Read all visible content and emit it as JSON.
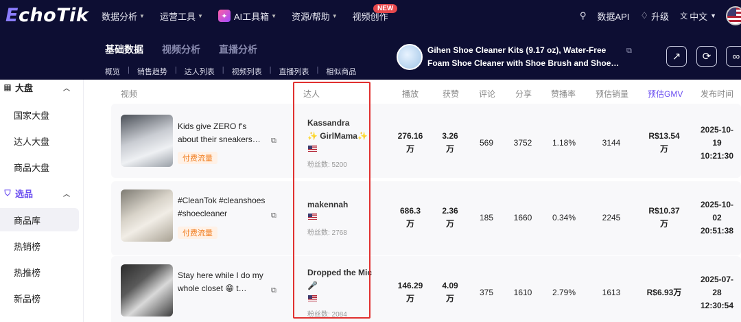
{
  "logo": {
    "first": "E",
    "rest": "choTik"
  },
  "nav": {
    "items": [
      {
        "label": "数据分析",
        "chevron": true
      },
      {
        "label": "运营工具",
        "chevron": true
      },
      {
        "label": "AI工具箱",
        "chevron": true,
        "icon": "ai-sparkle-icon"
      },
      {
        "label": "资源/帮助",
        "chevron": true
      },
      {
        "label": "视频创作",
        "chevron": false
      }
    ],
    "new_badge": "NEW",
    "right": {
      "data_api": "数据API",
      "upgrade": "升级",
      "language": "中文"
    }
  },
  "subheader": {
    "tabs": [
      "基础数据",
      "视频分析",
      "直播分析"
    ],
    "links": [
      "概览",
      "销售趋势",
      "达人列表",
      "视频列表",
      "直播列表",
      "相似商品"
    ],
    "product_title": "Gihen Shoe Cleaner Kits (9.17 oz), Water-Free Foam Shoe Cleaner with Shoe Brush and Shoe…"
  },
  "sidebar": {
    "group_market": "大盘",
    "items_market": [
      "国家大盘",
      "达人大盘",
      "商品大盘"
    ],
    "group_select": "选品",
    "items_select": [
      "商品库",
      "热销榜",
      "热推榜",
      "新品榜"
    ]
  },
  "table": {
    "headers": {
      "video": "视频",
      "creator": "达人",
      "plays": "播放",
      "likes": "获赞",
      "comments": "评论",
      "shares": "分享",
      "like_rate": "赞播率",
      "est_sales": "预估销量",
      "est_gmv": "预估GMV",
      "publish_time": "发布时间"
    },
    "rows": [
      {
        "title": "Kids give ZERO f's about their sneakers…",
        "paid": "付费流量",
        "creator_line1": "Kassandra",
        "creator_line2": "✨ GirlMama✨",
        "fans": "粉丝数: 5200",
        "plays": "276.16\n万",
        "likes": "3.26\n万",
        "comments": "569",
        "shares": "3752",
        "like_rate": "1.18%",
        "est_sales": "3144",
        "est_gmv": "R$13.54\n万",
        "publish_time": "2025-10-\n19\n10:21:30"
      },
      {
        "title": "#CleanTok #cleanshoes #shoecleaner",
        "paid": "付费流量",
        "creator_line1": "makennah",
        "creator_line2": "",
        "fans": "粉丝数: 2768",
        "plays": "686.3\n万",
        "likes": "2.36\n万",
        "comments": "185",
        "shares": "1660",
        "like_rate": "0.34%",
        "est_sales": "2245",
        "est_gmv": "R$10.37\n万",
        "publish_time": "2025-10-\n02\n20:51:38"
      },
      {
        "title": "Stay here while I do my whole closet 😁 t…",
        "paid": "",
        "creator_line1": "Dropped the Mic",
        "creator_line2": "🎤",
        "fans": "粉丝数: 2084",
        "plays": "146.29\n万",
        "likes": "4.09\n万",
        "comments": "375",
        "shares": "1610",
        "like_rate": "2.79%",
        "est_sales": "1613",
        "est_gmv": "R$6.93万",
        "publish_time": "2025-07-\n28\n12:30:54"
      }
    ]
  },
  "colors": {
    "nav_bg": "#0d0e33",
    "accent": "#6b4ef0",
    "highlight": "#e0302f",
    "paid_tag": "#f07a1a"
  }
}
